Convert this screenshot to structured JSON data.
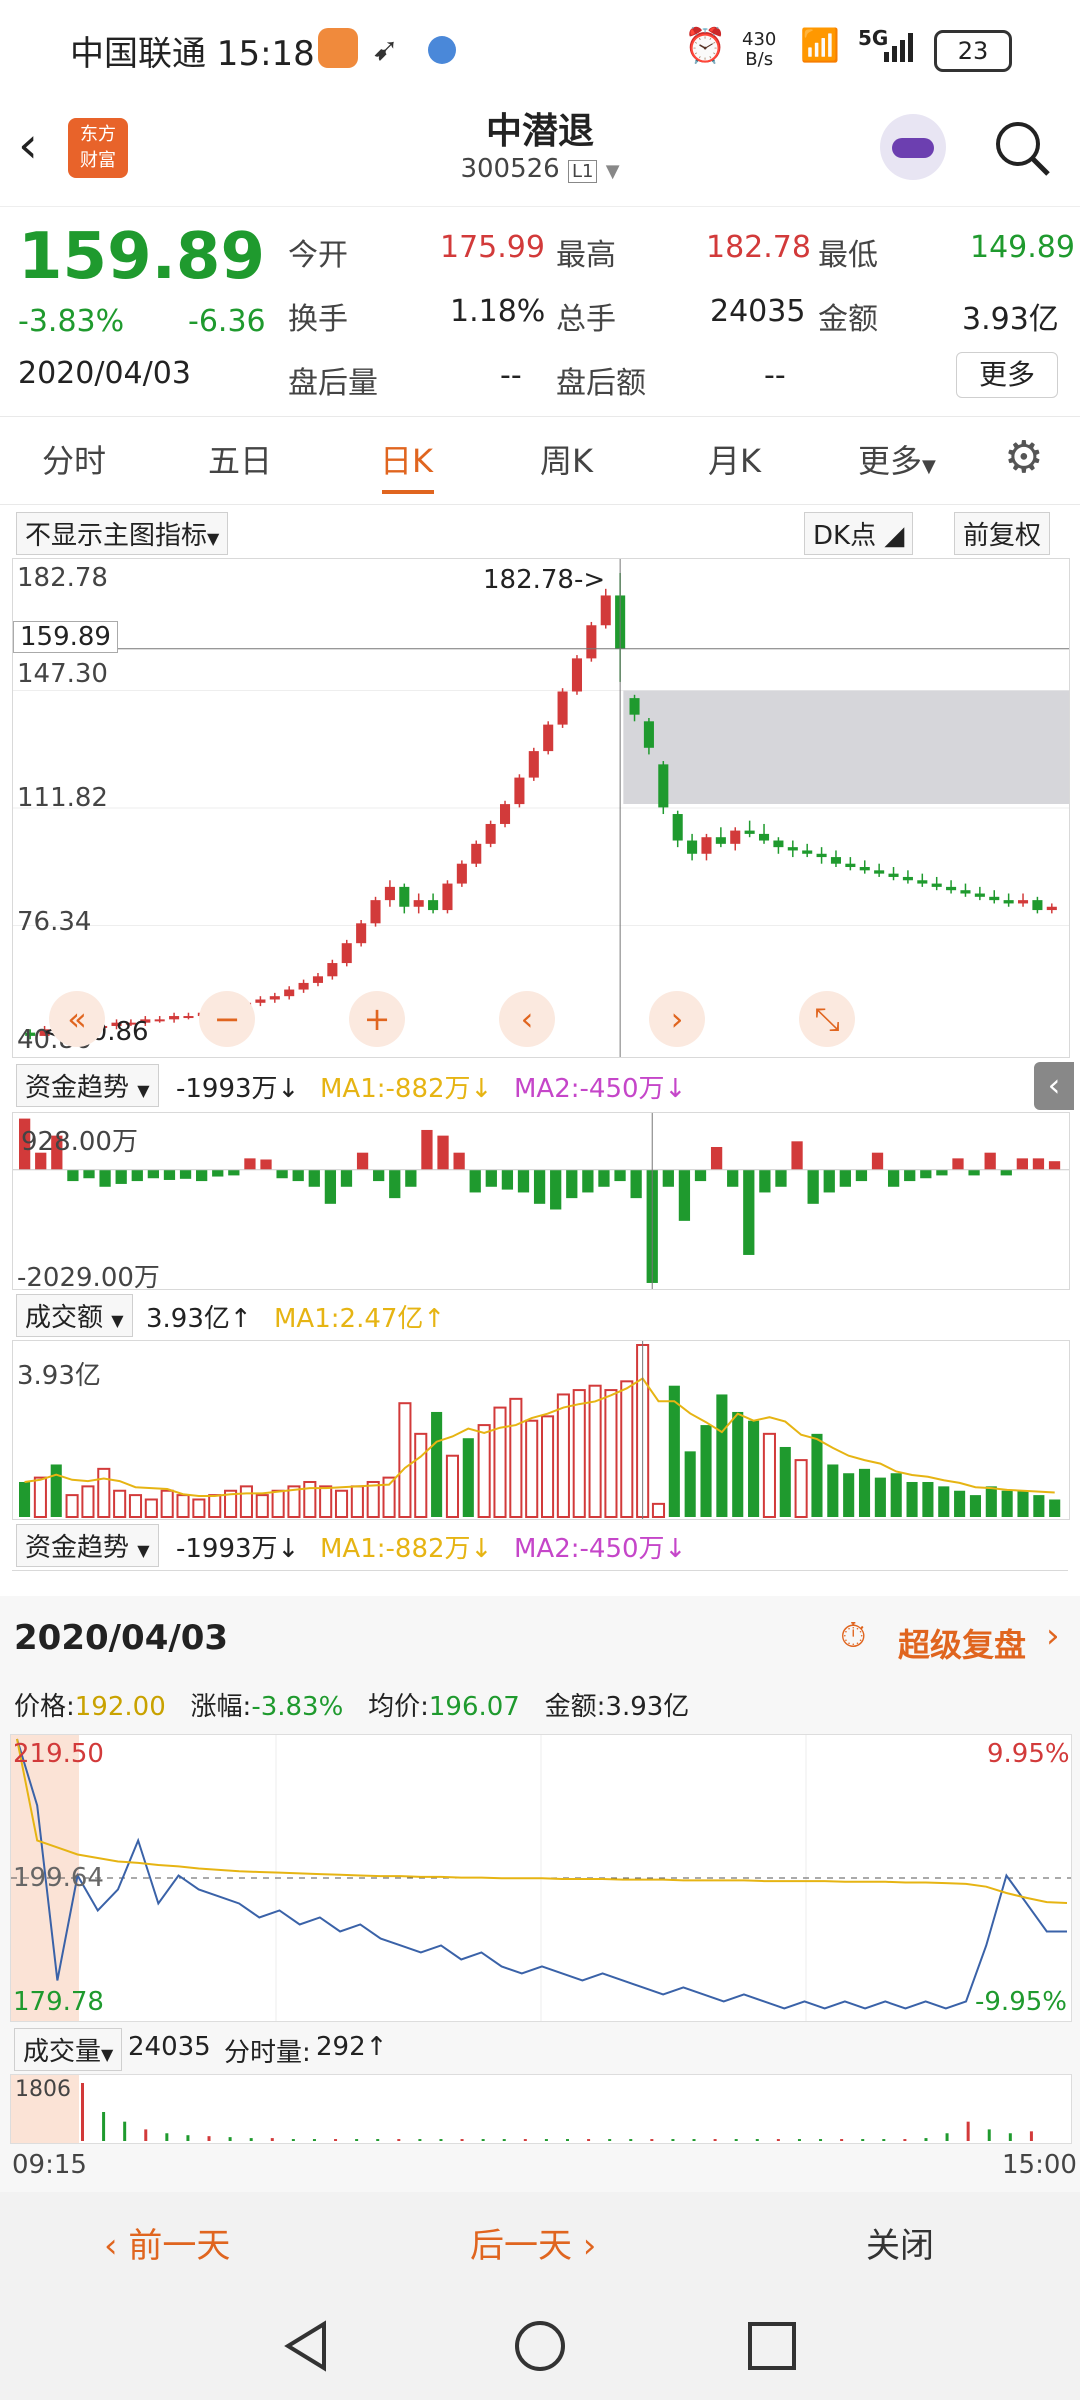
{
  "status": {
    "carrier_time": "中国联通 15:18",
    "net_speed_top": "430",
    "net_speed_bottom": "B/s",
    "net_type": "5G",
    "battery": "23"
  },
  "header": {
    "logo_line1": "东方",
    "logo_line2": "财富",
    "stock_name": "中潜退",
    "stock_code": "300526",
    "market_badge": "L1"
  },
  "quote": {
    "price": "159.89",
    "change_pct": "-3.83%",
    "change_abs": "-6.36",
    "date": "2020/04/03",
    "open_label": "今开",
    "open": "175.99",
    "high_label": "最高",
    "high": "182.78",
    "low_label": "最低",
    "low": "149.89",
    "turnover_label": "换手",
    "turnover": "1.18%",
    "volume_label": "总手",
    "volume": "24035",
    "amount_label": "金额",
    "amount": "3.93亿",
    "after_vol_label": "盘后量",
    "after_vol": "--",
    "after_amt_label": "盘后额",
    "after_amt": "--",
    "more_label": "更多"
  },
  "tabs": [
    "分时",
    "五日",
    "日K",
    "周K",
    "月K",
    "更多"
  ],
  "active_tab": 2,
  "kline": {
    "indicator_select": "不显示主图指标",
    "dk_button": "DK点",
    "adjust_button": "前复权",
    "y_top": "182.78",
    "cursor_price": "159.89",
    "y_2": "147.30",
    "y_3": "111.82",
    "y_4": "76.34",
    "y_bottom": "40.86",
    "peak_label": "182.78->",
    "low_label": "<-40.86"
  },
  "fund_flow": {
    "select_label": "资金趋势",
    "value": "-1993万↓",
    "ma1": "MA1:-882万↓",
    "ma2": "MA2:-450万↓",
    "y_top": "928.00万",
    "y_bottom": "-2029.00万"
  },
  "amount_chart": {
    "select_label": "成交额",
    "value": "3.93亿↑",
    "ma1": "MA1:2.47亿↑",
    "y_top": "3.93亿"
  },
  "fund_flow2": {
    "select_label": "资金趋势",
    "value": "-1993万↓",
    "ma1": "MA1:-882万↓",
    "ma2": "MA2:-450万↓"
  },
  "intraday": {
    "date": "2020/04/03",
    "replay_label": "超级复盘",
    "price_label": "价格:",
    "price": "192.00",
    "chg_label": "涨幅:",
    "chg": "-3.83%",
    "avg_label": "均价:",
    "avg": "196.07",
    "amount_label": "金额:",
    "amount": "3.93亿",
    "y_top": "219.50",
    "y_mid": "199.64",
    "y_bottom": "179.78",
    "pct_top": "9.95%",
    "pct_bottom": "-9.95%",
    "vol_select": "成交量",
    "vol": "24035",
    "vol_min_label": "分时量:",
    "vol_min": "292↑",
    "vol_y_top": "1806",
    "time_start": "09:15",
    "time_end": "15:00"
  },
  "bottom": {
    "prev_day": "前一天",
    "next_day": "后一天",
    "close": "关闭"
  },
  "chart_data": [
    {
      "type": "candlestick",
      "title": "日K",
      "ylim": [
        40.86,
        182.78
      ],
      "y_ticks": [
        182.78,
        147.3,
        111.82,
        76.34,
        40.86
      ],
      "ohlc": [
        [
          44,
          45,
          42,
          43
        ],
        [
          43,
          46,
          43,
          45
        ],
        [
          45,
          46,
          44,
          44
        ],
        [
          44,
          45,
          43,
          45
        ],
        [
          45,
          47,
          44,
          46
        ],
        [
          46,
          47,
          45,
          46
        ],
        [
          46,
          48,
          45,
          47
        ],
        [
          47,
          48,
          46,
          47
        ],
        [
          47,
          49,
          46,
          48
        ],
        [
          48,
          49,
          47,
          48
        ],
        [
          48,
          50,
          47,
          49
        ],
        [
          49,
          50,
          48,
          49
        ],
        [
          49,
          51,
          48,
          50
        ],
        [
          50,
          52,
          49,
          51
        ],
        [
          51,
          53,
          50,
          52
        ],
        [
          52,
          54,
          51,
          53
        ],
        [
          53,
          55,
          52,
          54
        ],
        [
          54,
          56,
          53,
          55
        ],
        [
          55,
          58,
          54,
          57
        ],
        [
          57,
          60,
          56,
          59
        ],
        [
          59,
          62,
          58,
          61
        ],
        [
          61,
          66,
          60,
          65
        ],
        [
          65,
          72,
          64,
          71
        ],
        [
          71,
          78,
          70,
          77
        ],
        [
          77,
          85,
          76,
          84
        ],
        [
          84,
          90,
          82,
          88
        ],
        [
          88,
          89,
          80,
          82
        ],
        [
          82,
          86,
          80,
          84
        ],
        [
          84,
          86,
          80,
          81
        ],
        [
          81,
          90,
          80,
          89
        ],
        [
          89,
          96,
          88,
          95
        ],
        [
          95,
          102,
          94,
          101
        ],
        [
          101,
          108,
          100,
          107
        ],
        [
          107,
          114,
          106,
          113
        ],
        [
          113,
          122,
          112,
          121
        ],
        [
          121,
          130,
          120,
          129
        ],
        [
          129,
          138,
          128,
          137
        ],
        [
          137,
          148,
          136,
          147
        ],
        [
          147,
          158,
          146,
          157
        ],
        [
          157,
          168,
          156,
          167
        ],
        [
          167,
          178,
          166,
          176
        ],
        [
          176,
          182.78,
          149.89,
          159.89
        ],
        [
          145,
          146,
          138,
          140
        ],
        [
          138,
          139,
          128,
          130
        ],
        [
          125,
          126,
          110,
          112
        ],
        [
          110,
          111,
          100,
          102
        ],
        [
          102,
          104,
          96,
          98
        ],
        [
          98,
          104,
          96,
          103
        ],
        [
          103,
          106,
          100,
          101
        ],
        [
          101,
          106,
          99,
          105
        ],
        [
          105,
          108,
          103,
          104
        ],
        [
          104,
          107,
          101,
          102
        ],
        [
          102,
          103,
          98,
          100
        ],
        [
          100,
          102,
          97,
          99
        ],
        [
          99,
          101,
          97,
          98
        ],
        [
          98,
          100,
          95,
          97
        ],
        [
          97,
          99,
          94,
          95
        ],
        [
          95,
          97,
          93,
          94
        ],
        [
          94,
          96,
          92,
          93
        ],
        [
          93,
          95,
          91,
          92
        ],
        [
          92,
          94,
          90,
          91
        ],
        [
          91,
          93,
          89,
          90
        ],
        [
          90,
          92,
          88,
          89
        ],
        [
          89,
          91,
          87,
          88
        ],
        [
          88,
          90,
          86,
          87
        ],
        [
          87,
          89,
          85,
          86
        ],
        [
          86,
          88,
          84,
          85
        ],
        [
          85,
          87,
          83,
          84
        ],
        [
          84,
          86,
          82,
          83
        ],
        [
          83,
          86,
          82,
          84
        ],
        [
          84,
          85,
          80,
          81
        ],
        [
          81,
          83,
          80,
          82
        ]
      ]
    },
    {
      "type": "bar",
      "title": "资金趋势",
      "ylim": [
        -2029,
        928
      ],
      "values": [
        900,
        300,
        600,
        -200,
        -150,
        -300,
        -250,
        -200,
        -150,
        -180,
        -160,
        -200,
        -120,
        -100,
        200,
        180,
        -150,
        -200,
        -300,
        -600,
        -300,
        300,
        -200,
        -500,
        -300,
        700,
        600,
        300,
        -400,
        -300,
        -350,
        -400,
        -600,
        -700,
        -500,
        -400,
        -300,
        -200,
        -500,
        -1993,
        -300,
        -900,
        -200,
        400,
        -300,
        -1500,
        -400,
        -300,
        500,
        -600,
        -400,
        -300,
        -200,
        300,
        -300,
        -200,
        -150,
        -100,
        200,
        -100,
        300,
        -100,
        200,
        200,
        150
      ],
      "ma1": "-882万",
      "ma2": "-450万"
    },
    {
      "type": "bar",
      "title": "成交额",
      "ylim": [
        0,
        3.93
      ],
      "values": [
        0.8,
        0.9,
        1.2,
        0.5,
        0.7,
        1.1,
        0.6,
        0.5,
        0.4,
        0.6,
        0.5,
        0.4,
        0.5,
        0.6,
        0.7,
        0.5,
        0.6,
        0.7,
        0.8,
        0.7,
        0.6,
        0.7,
        0.8,
        0.9,
        2.6,
        1.9,
        2.4,
        1.4,
        1.8,
        2.1,
        2.5,
        2.7,
        2.2,
        2.3,
        2.8,
        2.9,
        3.0,
        2.9,
        3.1,
        3.93,
        0.3,
        3.0,
        1.5,
        2.1,
        2.8,
        2.4,
        2.2,
        1.9,
        1.6,
        1.3,
        1.9,
        1.2,
        1.0,
        1.1,
        0.9,
        1.0,
        0.8,
        0.8,
        0.7,
        0.6,
        0.5,
        0.7,
        0.6,
        0.6,
        0.5,
        0.4
      ],
      "ma1": "2.47亿"
    },
    {
      "type": "line",
      "title": "分时",
      "ylim": [
        179.78,
        219.5
      ],
      "x_range": [
        "09:15",
        "15:00"
      ],
      "series": [
        {
          "name": "价格",
          "values": [
            219.5,
            210,
            185,
            200,
            195,
            198,
            205,
            196,
            200,
            198,
            197,
            196,
            194,
            195,
            193,
            194,
            192,
            193,
            191,
            190,
            189,
            190,
            188,
            189,
            187,
            186,
            187,
            186,
            185,
            186,
            185,
            184,
            183,
            184,
            183,
            182,
            183,
            182,
            181,
            182,
            181,
            182,
            181,
            182,
            181,
            182,
            181,
            182,
            190,
            200,
            196,
            192,
            192
          ]
        },
        {
          "name": "均价",
          "values": [
            219.5,
            205,
            204,
            203,
            202.5,
            202,
            201.8,
            201.5,
            201.3,
            201,
            200.8,
            200.6,
            200.5,
            200.4,
            200.3,
            200.2,
            200.1,
            200.0,
            199.9,
            199.9,
            199.8,
            199.8,
            199.7,
            199.7,
            199.6,
            199.6,
            199.6,
            199.5,
            199.5,
            199.5,
            199.4,
            199.4,
            199.4,
            199.3,
            199.3,
            199.3,
            199.3,
            199.2,
            199.2,
            199.2,
            199.2,
            199.1,
            199.1,
            199.1,
            199.0,
            199.0,
            198.9,
            198.8,
            198.4,
            197.5,
            196.8,
            196.2,
            196.07
          ]
        }
      ]
    }
  ]
}
